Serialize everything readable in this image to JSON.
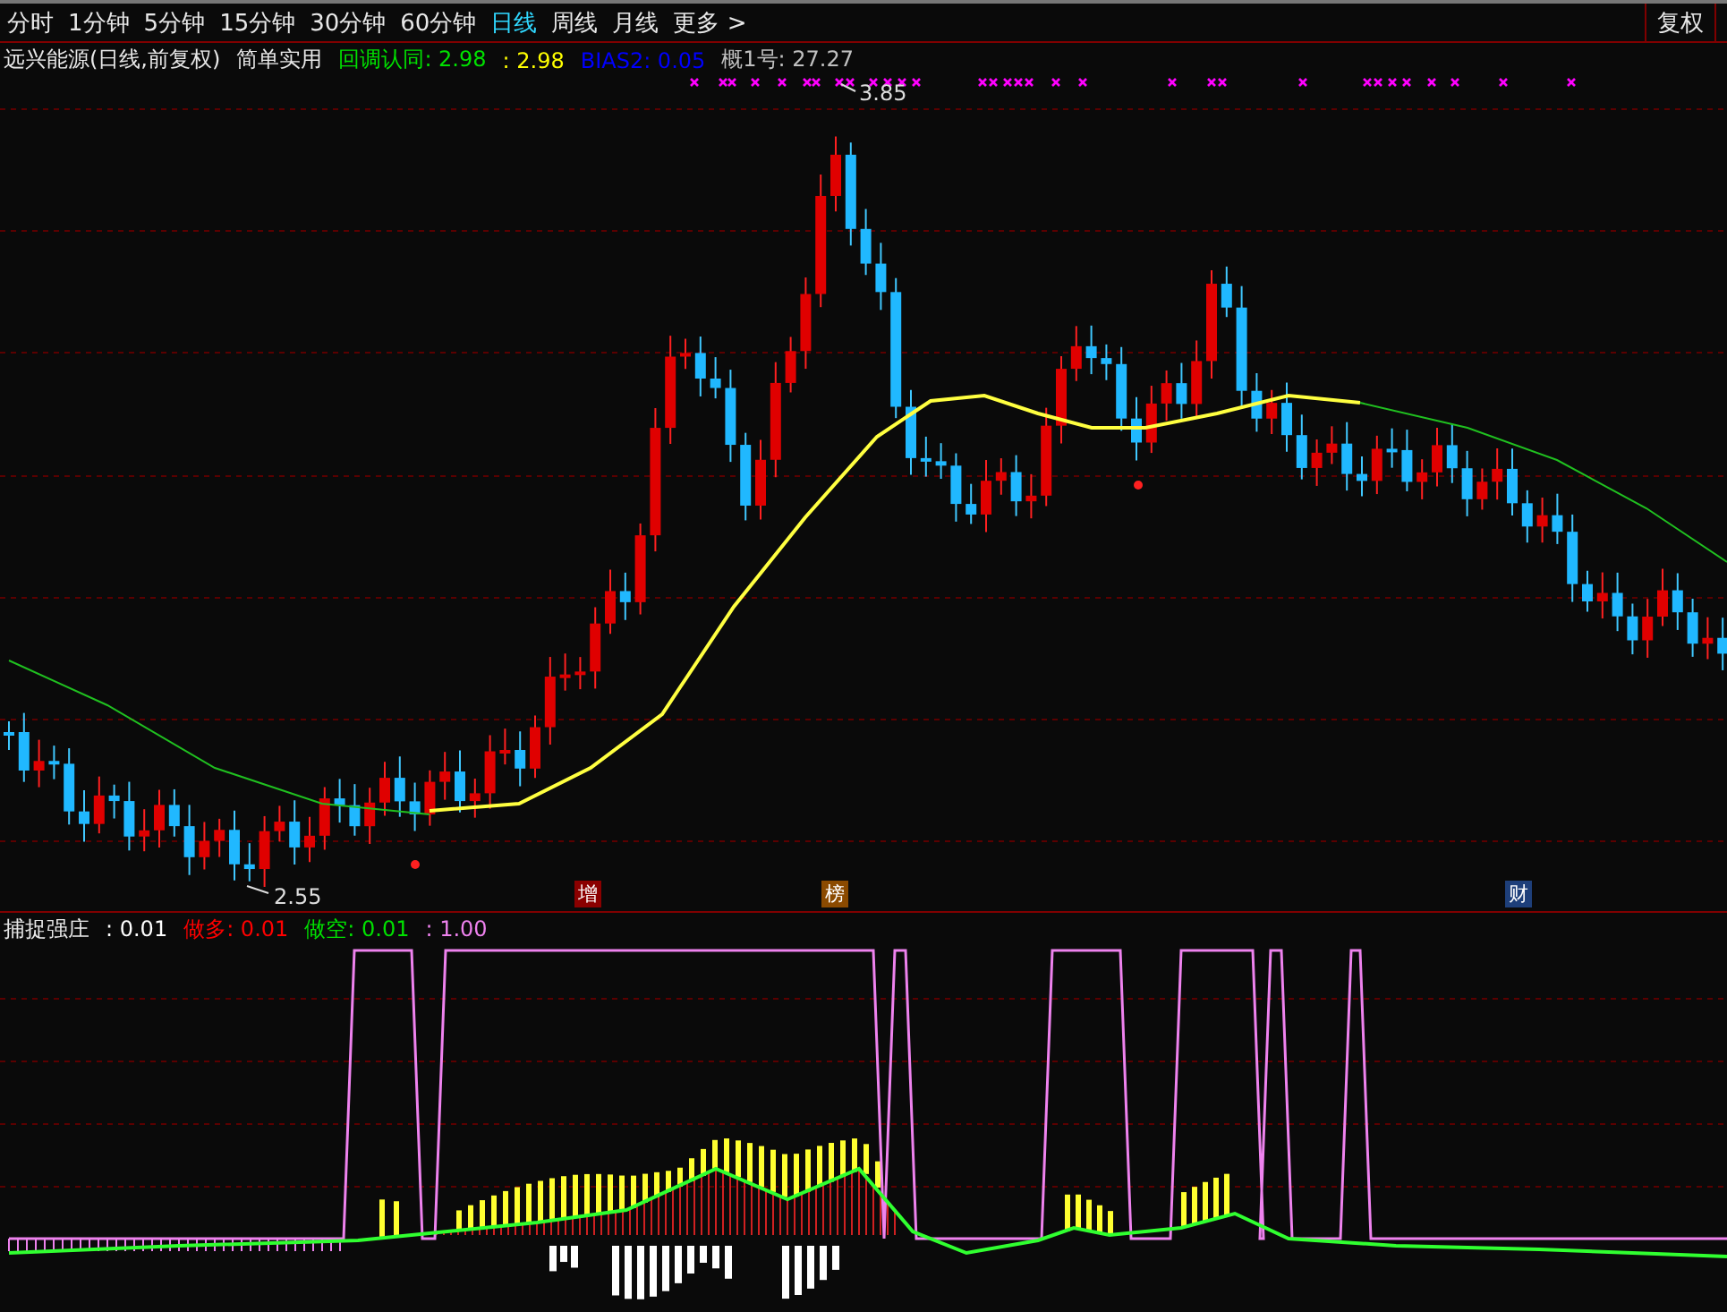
{
  "period_tabs": [
    {
      "label": "分时",
      "selected": false
    },
    {
      "label": "1分钟",
      "selected": false
    },
    {
      "label": "5分钟",
      "selected": false
    },
    {
      "label": "15分钟",
      "selected": false
    },
    {
      "label": "30分钟",
      "selected": false
    },
    {
      "label": "60分钟",
      "selected": false
    },
    {
      "label": "日线",
      "selected": true
    },
    {
      "label": "周线",
      "selected": false
    },
    {
      "label": "月线",
      "selected": false
    },
    {
      "label": "更多 >",
      "selected": false
    }
  ],
  "toolbar_buttons": [
    "复权"
  ],
  "main_legend": {
    "title": "远兴能源(日线,前复权)",
    "indicator": "简单实用",
    "items": [
      {
        "label": "回调认同: 2.98",
        "color": "#00e000"
      },
      {
        "label": ": 2.98",
        "color": "#ffff00"
      },
      {
        "label": "BIAS2: 0.05",
        "color": "#0000ff"
      },
      {
        "label": "概1号: 27.27",
        "color": "#c0c0c0"
      }
    ]
  },
  "price_labels": [
    {
      "text": "3.85"
    },
    {
      "text": "2.55"
    }
  ],
  "event_badges": [
    {
      "text": "增",
      "color": "#8b0000"
    },
    {
      "text": "榜",
      "color": "#8b4a00"
    },
    {
      "text": "财",
      "color": "#1e3f7a"
    }
  ],
  "sub_legend": {
    "title": "捕捉强庄",
    "items": [
      {
        "label": ": 0.01",
        "color": "#ffffff"
      },
      {
        "label": "做多: 0.01",
        "color": "#ff0000"
      },
      {
        "label": "做空: 0.01",
        "color": "#00e000"
      },
      {
        "label": ": 1.00",
        "color": "#ee82ee"
      }
    ]
  }
}
